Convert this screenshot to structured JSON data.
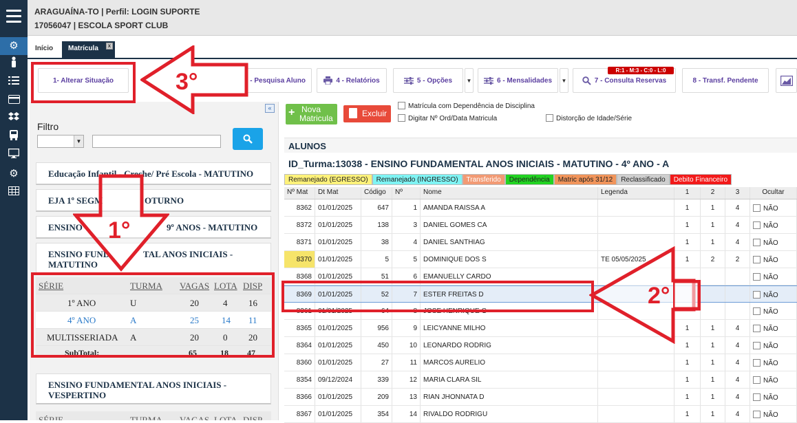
{
  "header": {
    "line1": "ARAGUAÍNA-TO | Perfil: LOGIN SUPORTE",
    "line2": "17056047 | ESCOLA SPORT CLUB"
  },
  "tabs": [
    {
      "label": "Início"
    },
    {
      "label": "Matrícula",
      "close": "x"
    }
  ],
  "toolbar": {
    "alterar": "1- Alterar Situação",
    "pesquisa": "- Pesquisa Aluno",
    "relatorios": "4 - Relatórios",
    "opcoes": "5 - Opções",
    "mensalidades": "6 - Mensalidades",
    "consulta": "7 - Consulta Reservas",
    "consulta_badge": "R:1 - M:3 - C:0 - L:0",
    "transf": "8 - Transf. Pendente"
  },
  "filter": {
    "label": "Filtro"
  },
  "groups": [
    {
      "label": "Educação Infantil - Creche/ Pré Escola - MATUTINO"
    },
    {
      "label": "EJA 1º SEGM",
      "label_b": "OTURNO"
    },
    {
      "label": "ENSINO",
      "label_b": "9º ANOS - MATUTINO"
    },
    {
      "label": "ENSINO FUND",
      "label_b": "TAL ANOS INICIAIS -",
      "label_c": "MATUTINO"
    },
    {
      "label": "ENSINO FUNDAMENTAL ANOS INICIAIS -",
      "label_c": "VESPERTINO"
    }
  ],
  "serie_table": {
    "headers": [
      "SÉRIE",
      "TURMA",
      "VAGAS",
      "LOTA",
      "DISP"
    ],
    "rows": [
      {
        "serie": "1º ANO",
        "turma": "U",
        "vagas": "20",
        "lota": "4",
        "disp": "16"
      },
      {
        "serie": "4º ANO",
        "turma": "A",
        "vagas": "25",
        "lota": "14",
        "disp": "11"
      },
      {
        "serie": "MULTISSERIADA",
        "turma": "A",
        "vagas": "20",
        "lota": "0",
        "disp": "20"
      }
    ],
    "subtotal": {
      "label": "SubTotal:",
      "vagas": "65",
      "lota": "18",
      "disp": "47"
    }
  },
  "actions": {
    "nova": "Nova",
    "nova2": "Matricula",
    "excluir": "Excluir",
    "ck1": "Matrícula com Dependência de Disciplina",
    "ck2": "Digitar Nº Ord/Data Matricula",
    "ck3": "Distorção de Idade/Série"
  },
  "alunos_title": "ALUNOS",
  "turma_title": "ID_Turma:13038 - ENSINO FUNDAMENTAL ANOS INICIAIS - MATUTINO - 4º ANO - A",
  "legend": [
    {
      "label": "Remanejado (EGRESSO)",
      "bg": "#fff27a",
      "fg": "#222"
    },
    {
      "label": "Remanejado (INGRESSO)",
      "bg": "#7ff4f4",
      "fg": "#222"
    },
    {
      "label": "Transferido",
      "bg": "#f29a74",
      "fg": "#fff"
    },
    {
      "label": "Dependência",
      "bg": "#22d322",
      "fg": "#222"
    },
    {
      "label": "Matric após 31/12",
      "bg": "#f1945a",
      "fg": "#222"
    },
    {
      "label": "Reclassificado",
      "bg": "#cfcfcf",
      "fg": "#222"
    },
    {
      "label": "Debito Financeiro",
      "bg": "#f21a1a",
      "fg": "#fff"
    }
  ],
  "grid": {
    "headers": [
      "Nº Mat",
      "Dt Mat",
      "Código",
      "Nº",
      "Nome",
      "Legenda",
      "1",
      "2",
      "3",
      "Ocultar"
    ],
    "rows": [
      {
        "mat": "8362",
        "dt": "01/01/2025",
        "cod": "647",
        "n": "1",
        "nome": "AMANDA RAISSA A",
        "leg": "",
        "c1": "1",
        "c2": "1",
        "c3": "4",
        "oc": "NÃO"
      },
      {
        "mat": "8372",
        "dt": "01/01/2025",
        "cod": "138",
        "n": "3",
        "nome": "DANIEL GOMES CA",
        "leg": "",
        "c1": "1",
        "c2": "1",
        "c3": "4",
        "oc": "NÃO"
      },
      {
        "mat": "8371",
        "dt": "01/01/2025",
        "cod": "38",
        "n": "4",
        "nome": "DANIEL SANTHIAG",
        "leg": "",
        "c1": "1",
        "c2": "1",
        "c3": "4",
        "oc": "NÃO"
      },
      {
        "mat": "8370",
        "dt": "01/01/2025",
        "cod": "5",
        "n": "5",
        "nome": "DOMINIQUE DOS S",
        "leg": "TE 05/05/2025",
        "c1": "1",
        "c2": "2",
        "c3": "2",
        "oc": "NÃO"
      },
      {
        "mat": "8368",
        "dt": "01/01/2025",
        "cod": "51",
        "n": "6",
        "nome": "EMANUELLY CARDO",
        "leg": "",
        "c1": "",
        "c2": "",
        "c3": "",
        "oc": "NÃO"
      },
      {
        "mat": "8369",
        "dt": "01/01/2025",
        "cod": "52",
        "n": "7",
        "nome": "ESTER FREITAS D",
        "leg": "",
        "c1": "",
        "c2": "",
        "c3": "",
        "oc": "NÃO"
      },
      {
        "mat": "8361",
        "dt": "01/01/2025",
        "cod": "64",
        "n": "8",
        "nome": "JOSE HENRIQUE G",
        "leg": "",
        "c1": "",
        "c2": "",
        "c3": "",
        "oc": "NÃO"
      },
      {
        "mat": "8365",
        "dt": "01/01/2025",
        "cod": "956",
        "n": "9",
        "nome": "LEICYANNE MILHO",
        "leg": "",
        "c1": "1",
        "c2": "1",
        "c3": "4",
        "oc": "NÃO"
      },
      {
        "mat": "8364",
        "dt": "01/01/2025",
        "cod": "450",
        "n": "10",
        "nome": "LEONARDO RODRIG",
        "leg": "",
        "c1": "1",
        "c2": "1",
        "c3": "4",
        "oc": "NÃO"
      },
      {
        "mat": "8360",
        "dt": "01/01/2025",
        "cod": "27",
        "n": "11",
        "nome": "MARCOS AURELIO",
        "leg": "",
        "c1": "1",
        "c2": "1",
        "c3": "4",
        "oc": "NÃO"
      },
      {
        "mat": "8354",
        "dt": "09/12/2024",
        "cod": "339",
        "n": "12",
        "nome": "MARIA CLARA SIL",
        "leg": "",
        "c1": "1",
        "c2": "1",
        "c3": "4",
        "oc": "NÃO"
      },
      {
        "mat": "8366",
        "dt": "01/01/2025",
        "cod": "209",
        "n": "13",
        "nome": "RIAN JHONNATA D",
        "leg": "",
        "c1": "1",
        "c2": "1",
        "c3": "4",
        "oc": "NÃO"
      },
      {
        "mat": "8367",
        "dt": "01/01/2025",
        "cod": "354",
        "n": "14",
        "nome": "RIVALDO RODRIGU",
        "leg": "",
        "c1": "1",
        "c2": "1",
        "c3": "4",
        "oc": "NÃO"
      }
    ]
  },
  "annotations": {
    "a1": "1°",
    "a2": "2°",
    "a3": "3°"
  },
  "colors": {
    "accent": "#1c3247",
    "annotation_red": "#e0202a",
    "search_button": "#1aa3e8",
    "new_button": "#70c04a",
    "delete_button": "#e84a3a"
  }
}
